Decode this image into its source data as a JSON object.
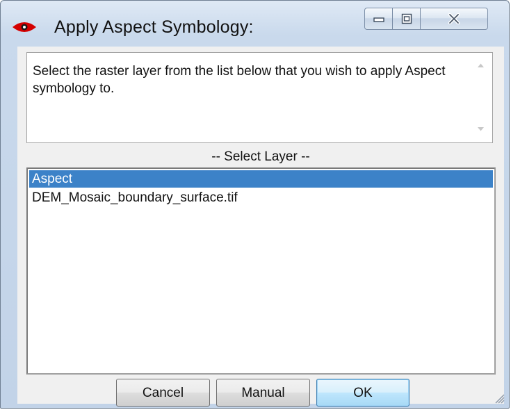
{
  "window": {
    "title": "Apply Aspect Symbology:",
    "icon": "red-eye-icon",
    "controls": [
      "minimize-icon",
      "maximize-icon",
      "close-icon"
    ]
  },
  "message": {
    "text": "Select the raster layer from the list below that you wish to apply Aspect symbology to."
  },
  "layer_section": {
    "caption": "-- Select Layer --",
    "items": [
      {
        "label": "Aspect",
        "selected": true
      },
      {
        "label": "DEM_Mosaic_boundary_surface.tif",
        "selected": false
      }
    ]
  },
  "buttons": {
    "cancel": "Cancel",
    "manual": "Manual",
    "ok": "OK"
  },
  "colors": {
    "selection": "#3c82c8",
    "icon_red": "#d40000"
  }
}
